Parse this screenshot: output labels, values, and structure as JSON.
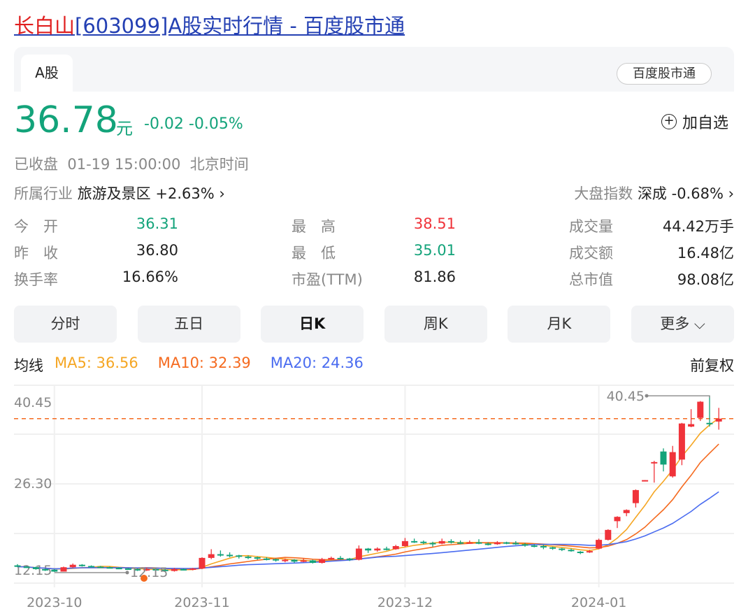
{
  "title": {
    "name": "长白山",
    "rest": "[603099]A股实时行情 - 百度股市通"
  },
  "tab": "A股",
  "source_badge": "百度股市通",
  "quote": {
    "price": "36.78",
    "unit": "元",
    "change": "-0.02 -0.05%",
    "add_label": "加自选",
    "add_icon": "plus-circle-icon",
    "status": "已收盘  01-19 15:00:00  北京时间",
    "industry_label": "所属行业",
    "industry": "旅游及景区 +2.63%",
    "index_label": "大盘指数",
    "index": "深成 -0.68%"
  },
  "stats": [
    {
      "label": "今　开",
      "value": "36.31",
      "color": "#13a37a"
    },
    {
      "label": "最　高",
      "value": "38.51",
      "color": "#f0333a"
    },
    {
      "label": "成交量",
      "value": "44.42万手",
      "color": "#222"
    },
    {
      "label": "昨　收",
      "value": "36.80",
      "color": "#222"
    },
    {
      "label": "最　低",
      "value": "35.01",
      "color": "#13a37a"
    },
    {
      "label": "成交额",
      "value": "16.48亿",
      "color": "#222"
    },
    {
      "label": "换手率",
      "value": "16.66%",
      "color": "#222"
    },
    {
      "label": "市盈(TTM)",
      "value": "81.86",
      "color": "#222"
    },
    {
      "label": "总市值",
      "value": "98.08亿",
      "color": "#222"
    }
  ],
  "periods": [
    "分时",
    "五日",
    "日K",
    "周K",
    "月K",
    "更多"
  ],
  "ma": {
    "label": "均线",
    "ma5": "MA5: 36.56",
    "ma10": "MA10: 32.39",
    "ma20": "MA20: 24.36",
    "adjust": "前复权"
  },
  "colors": {
    "up": "#f0333a",
    "down": "#13a37a",
    "ma5": "#f5a623",
    "ma10": "#f56a1f",
    "ma20": "#4a6cf0"
  },
  "chart_data": {
    "type": "candlestick",
    "title": "日K",
    "yticks": [
      "40.45",
      "26.30",
      "12.15"
    ],
    "ylim": [
      12.15,
      40.45
    ],
    "xlabels": [
      {
        "label": "2023-10",
        "index": 4
      },
      {
        "label": "2023-11",
        "index": 20
      },
      {
        "label": "2023-12",
        "index": 42
      },
      {
        "label": "2024-01",
        "index": 63
      }
    ],
    "last_close": 36.78,
    "max_label": "40.45",
    "min_label": "12.15",
    "ohlc_fields": [
      "open",
      "close",
      "high",
      "low"
    ],
    "candles": [
      [
        13.2,
        13.0,
        13.4,
        12.9
      ],
      [
        13.0,
        12.9,
        13.1,
        12.8
      ],
      [
        12.9,
        12.6,
        13.0,
        12.5
      ],
      [
        12.6,
        12.5,
        12.7,
        12.3
      ],
      [
        12.5,
        12.2,
        12.6,
        12.15
      ],
      [
        12.2,
        12.9,
        13.0,
        12.2
      ],
      [
        12.9,
        13.3,
        13.5,
        12.8
      ],
      [
        13.3,
        13.1,
        13.4,
        13.0
      ],
      [
        13.1,
        13.0,
        13.2,
        12.9
      ],
      [
        13.0,
        12.9,
        13.1,
        12.8
      ],
      [
        12.9,
        12.8,
        13.0,
        12.7
      ],
      [
        12.8,
        12.7,
        12.9,
        12.6
      ],
      [
        12.7,
        12.6,
        12.8,
        12.5
      ],
      [
        12.6,
        12.4,
        12.7,
        12.3
      ],
      [
        12.4,
        12.6,
        12.8,
        12.3
      ],
      [
        12.6,
        12.5,
        12.7,
        12.4
      ],
      [
        12.5,
        12.3,
        12.6,
        12.2
      ],
      [
        12.3,
        12.6,
        12.8,
        12.2
      ],
      [
        12.6,
        12.5,
        12.7,
        12.4
      ],
      [
        12.5,
        12.7,
        12.8,
        12.4
      ],
      [
        12.7,
        14.4,
        14.5,
        12.6
      ],
      [
        14.4,
        15.0,
        15.8,
        14.2
      ],
      [
        15.0,
        14.9,
        15.6,
        14.6
      ],
      [
        14.9,
        14.8,
        15.3,
        14.5
      ],
      [
        14.8,
        14.6,
        14.9,
        14.3
      ],
      [
        14.6,
        14.5,
        14.8,
        14.2
      ],
      [
        14.5,
        14.3,
        14.6,
        14.1
      ],
      [
        14.3,
        14.2,
        14.5,
        14.0
      ],
      [
        14.2,
        14.0,
        14.3,
        13.8
      ],
      [
        14.0,
        14.1,
        14.3,
        13.7
      ],
      [
        14.1,
        13.8,
        14.2,
        13.6
      ],
      [
        13.8,
        14.0,
        14.3,
        13.7
      ],
      [
        14.0,
        13.6,
        14.1,
        13.5
      ],
      [
        13.6,
        14.2,
        14.4,
        13.5
      ],
      [
        14.2,
        14.4,
        14.6,
        14.1
      ],
      [
        14.4,
        14.3,
        14.7,
        14.1
      ],
      [
        14.3,
        14.1,
        14.4,
        13.9
      ],
      [
        14.1,
        15.9,
        16.4,
        14.0
      ],
      [
        15.9,
        15.6,
        16.0,
        15.2
      ],
      [
        15.6,
        15.9,
        16.1,
        15.4
      ],
      [
        15.9,
        15.8,
        16.2,
        15.6
      ],
      [
        15.8,
        16.3,
        16.5,
        15.7
      ],
      [
        16.3,
        17.1,
        17.6,
        16.2
      ],
      [
        17.1,
        17.0,
        17.5,
        16.8
      ],
      [
        17.0,
        16.8,
        17.2,
        16.6
      ],
      [
        16.8,
        16.7,
        17.0,
        16.2
      ],
      [
        16.7,
        17.1,
        17.5,
        16.6
      ],
      [
        17.1,
        16.9,
        17.4,
        16.7
      ],
      [
        16.9,
        16.8,
        17.2,
        16.6
      ],
      [
        16.8,
        16.9,
        17.2,
        16.7
      ],
      [
        16.9,
        16.7,
        17.4,
        16.6
      ],
      [
        16.7,
        16.6,
        16.9,
        16.4
      ],
      [
        16.6,
        16.9,
        17.1,
        16.5
      ],
      [
        16.9,
        16.8,
        17.0,
        16.6
      ],
      [
        16.8,
        16.6,
        17.1,
        16.5
      ],
      [
        16.6,
        16.4,
        16.8,
        16.2
      ],
      [
        16.4,
        16.3,
        16.6,
        16.1
      ],
      [
        16.3,
        16.1,
        16.5,
        15.8
      ],
      [
        16.1,
        15.9,
        16.2,
        15.7
      ],
      [
        15.9,
        15.7,
        16.0,
        15.5
      ],
      [
        15.7,
        15.6,
        15.9,
        15.4
      ],
      [
        15.4,
        15.2,
        15.5,
        15.0
      ],
      [
        15.3,
        15.5,
        15.7,
        15.2
      ],
      [
        15.9,
        17.3,
        17.5,
        15.8
      ],
      [
        17.3,
        18.9,
        19.0,
        17.2
      ],
      [
        20.3,
        21.0,
        21.1,
        19.2
      ],
      [
        21.6,
        22.1,
        22.2,
        21.1
      ],
      [
        23.2,
        25.3,
        25.4,
        22.5
      ],
      [
        26.8,
        26.9,
        26.9,
        26.8
      ],
      [
        29.6,
        29.8,
        30.0,
        26.5
      ],
      [
        31.5,
        29.4,
        32.0,
        28.3
      ],
      [
        27.5,
        31.4,
        32.4,
        27.3
      ],
      [
        30.2,
        36.0,
        36.1,
        29.3
      ],
      [
        35.5,
        35.9,
        38.3,
        35.4
      ],
      [
        36.9,
        39.5,
        39.6,
        36.4
      ],
      [
        36.1,
        36.0,
        40.45,
        35.5
      ],
      [
        36.31,
        36.78,
        38.51,
        35.01
      ]
    ]
  }
}
